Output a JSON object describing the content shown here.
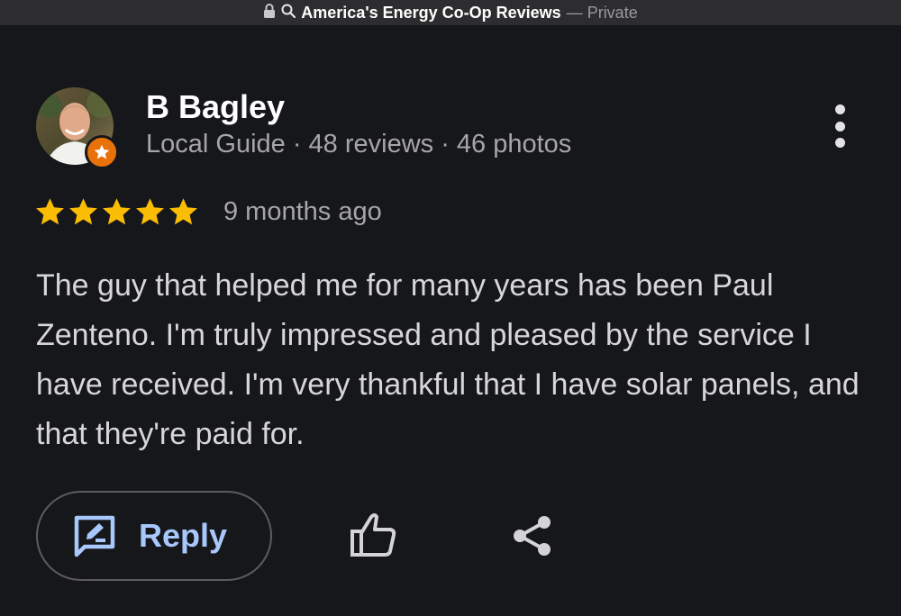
{
  "window": {
    "title": "America's Energy Co-Op Reviews",
    "separator": "—",
    "mode": "Private",
    "icons": [
      "lock-icon",
      "search-icon"
    ]
  },
  "review": {
    "author": "B Bagley",
    "author_meta": "Local Guide · 48 reviews · 46 photos",
    "rating": 5,
    "rating_max": 5,
    "time_ago": "9 months ago",
    "text": "The guy that helped me for many years has been Paul Zenteno. I'm truly impressed and pleased by the service I have received. I'm very thankful that I have solar panels, and that they're paid for."
  },
  "actions": {
    "reply_label": "Reply",
    "icons": [
      "reply-icon",
      "like-icon",
      "share-icon",
      "more-options-icon"
    ]
  },
  "colors": {
    "background": "#16171b",
    "star": "#fbbc04",
    "reply_text": "#a8c7fa",
    "badge": "#e8710a"
  }
}
